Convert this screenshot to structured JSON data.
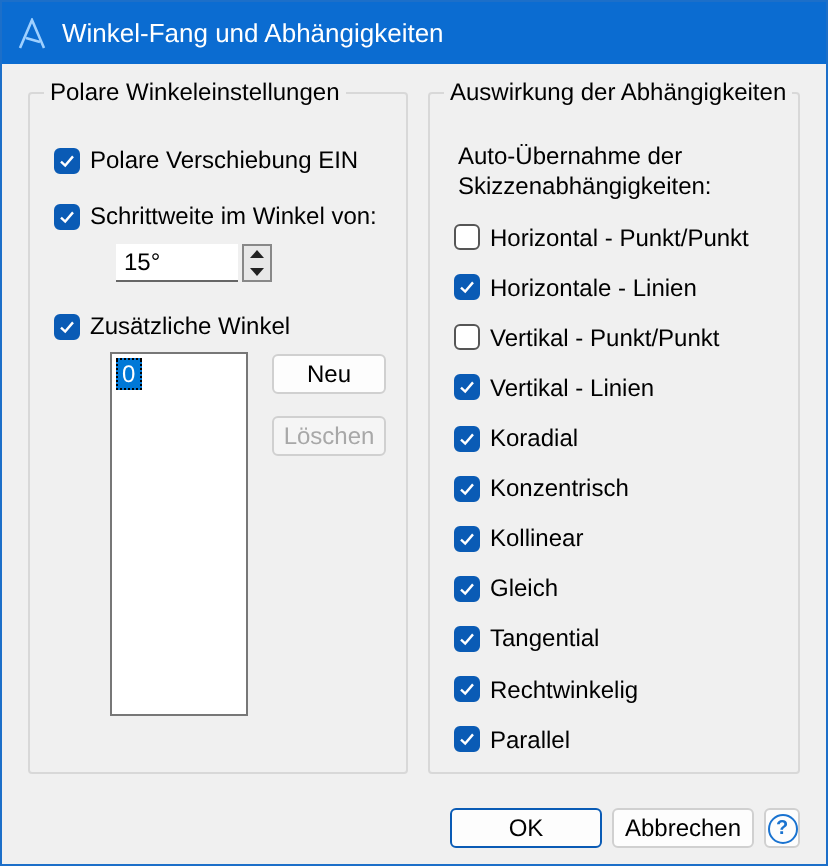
{
  "window": {
    "title": "Winkel-Fang und Abhängigkeiten"
  },
  "polar": {
    "title": "Polare Winkeleinstellungen",
    "options": [
      {
        "label": "Polare Verschiebung EIN",
        "checked": true
      },
      {
        "label": "Schrittweite im Winkel von:",
        "checked": true
      }
    ],
    "step_value": "15°",
    "extra": {
      "label": "Zusätzliche Winkel",
      "checked": true
    },
    "angle_list": [
      {
        "text": "0",
        "selected": true
      }
    ],
    "buttons": [
      {
        "label": "Neu",
        "disabled": false
      },
      {
        "label": "Löschen",
        "disabled": true
      }
    ]
  },
  "constraints": {
    "title": "Auswirkung der Abhängigkeiten",
    "description": "Auto-Übernahme der Skizzenabhängigkeiten:",
    "items": [
      {
        "label": "Horizontal - Punkt/Punkt",
        "checked": false
      },
      {
        "label": "Horizontale - Linien",
        "checked": true
      },
      {
        "label": "Vertikal - Punkt/Punkt",
        "checked": false
      },
      {
        "label": "Vertikal - Linien",
        "checked": true
      },
      {
        "label": "Koradial",
        "checked": true
      },
      {
        "label": "Konzentrisch",
        "checked": true
      },
      {
        "label": "Kollinear",
        "checked": true
      },
      {
        "label": "Gleich",
        "checked": true
      },
      {
        "label": "Tangential",
        "checked": true
      },
      {
        "label": "Rechtwinkelig",
        "checked": true
      },
      {
        "label": "Parallel",
        "checked": true
      }
    ]
  },
  "footer": {
    "buttons": [
      {
        "label": "OK",
        "kind": "default"
      },
      {
        "label": "Abbrechen",
        "kind": "normal"
      }
    ],
    "help": "?"
  }
}
